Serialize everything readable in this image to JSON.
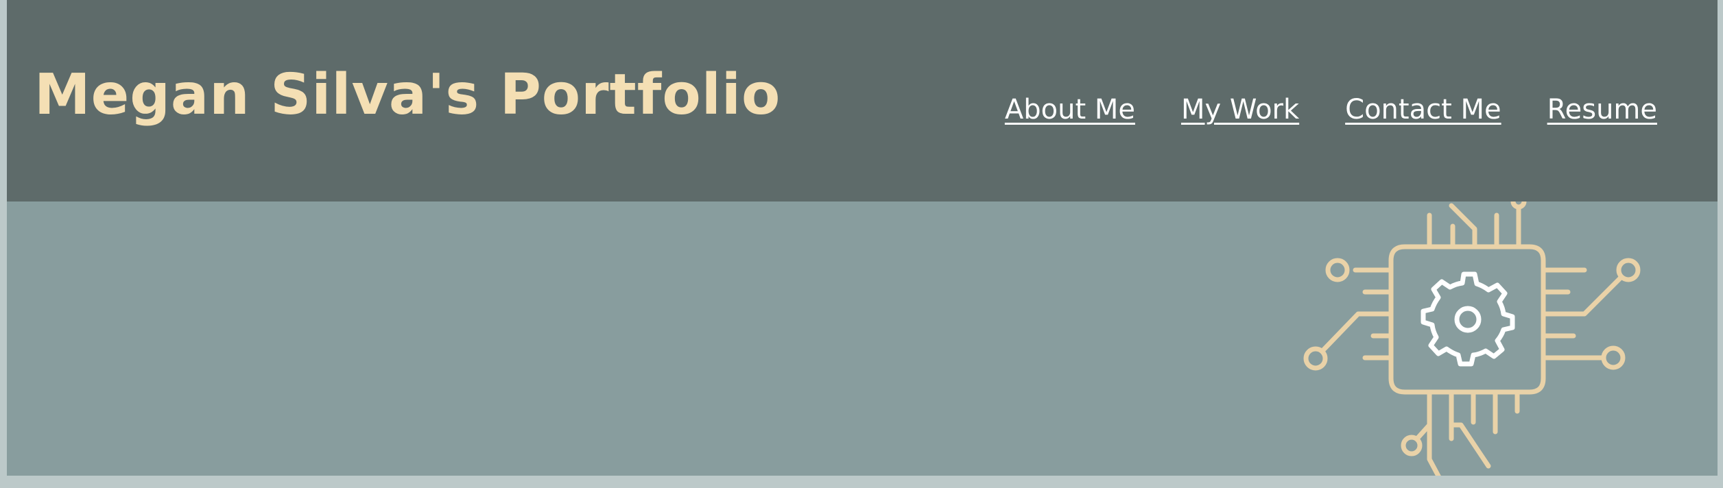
{
  "header": {
    "title": "Megan Silva's Portfolio"
  },
  "nav": {
    "items": [
      {
        "label": "About Me"
      },
      {
        "label": "My Work"
      },
      {
        "label": "Contact Me"
      },
      {
        "label": "Resume"
      }
    ]
  },
  "hero": {
    "graphic_icon": "circuit-chip-gear-icon"
  },
  "colors": {
    "page_background": "#bcc9c9",
    "header_background": "#5e6b6a",
    "title_color": "#f4dfb4",
    "nav_link_color": "#ffffff",
    "hero_background": "#889d9e",
    "graphic_stroke": "#e9d2a8"
  }
}
